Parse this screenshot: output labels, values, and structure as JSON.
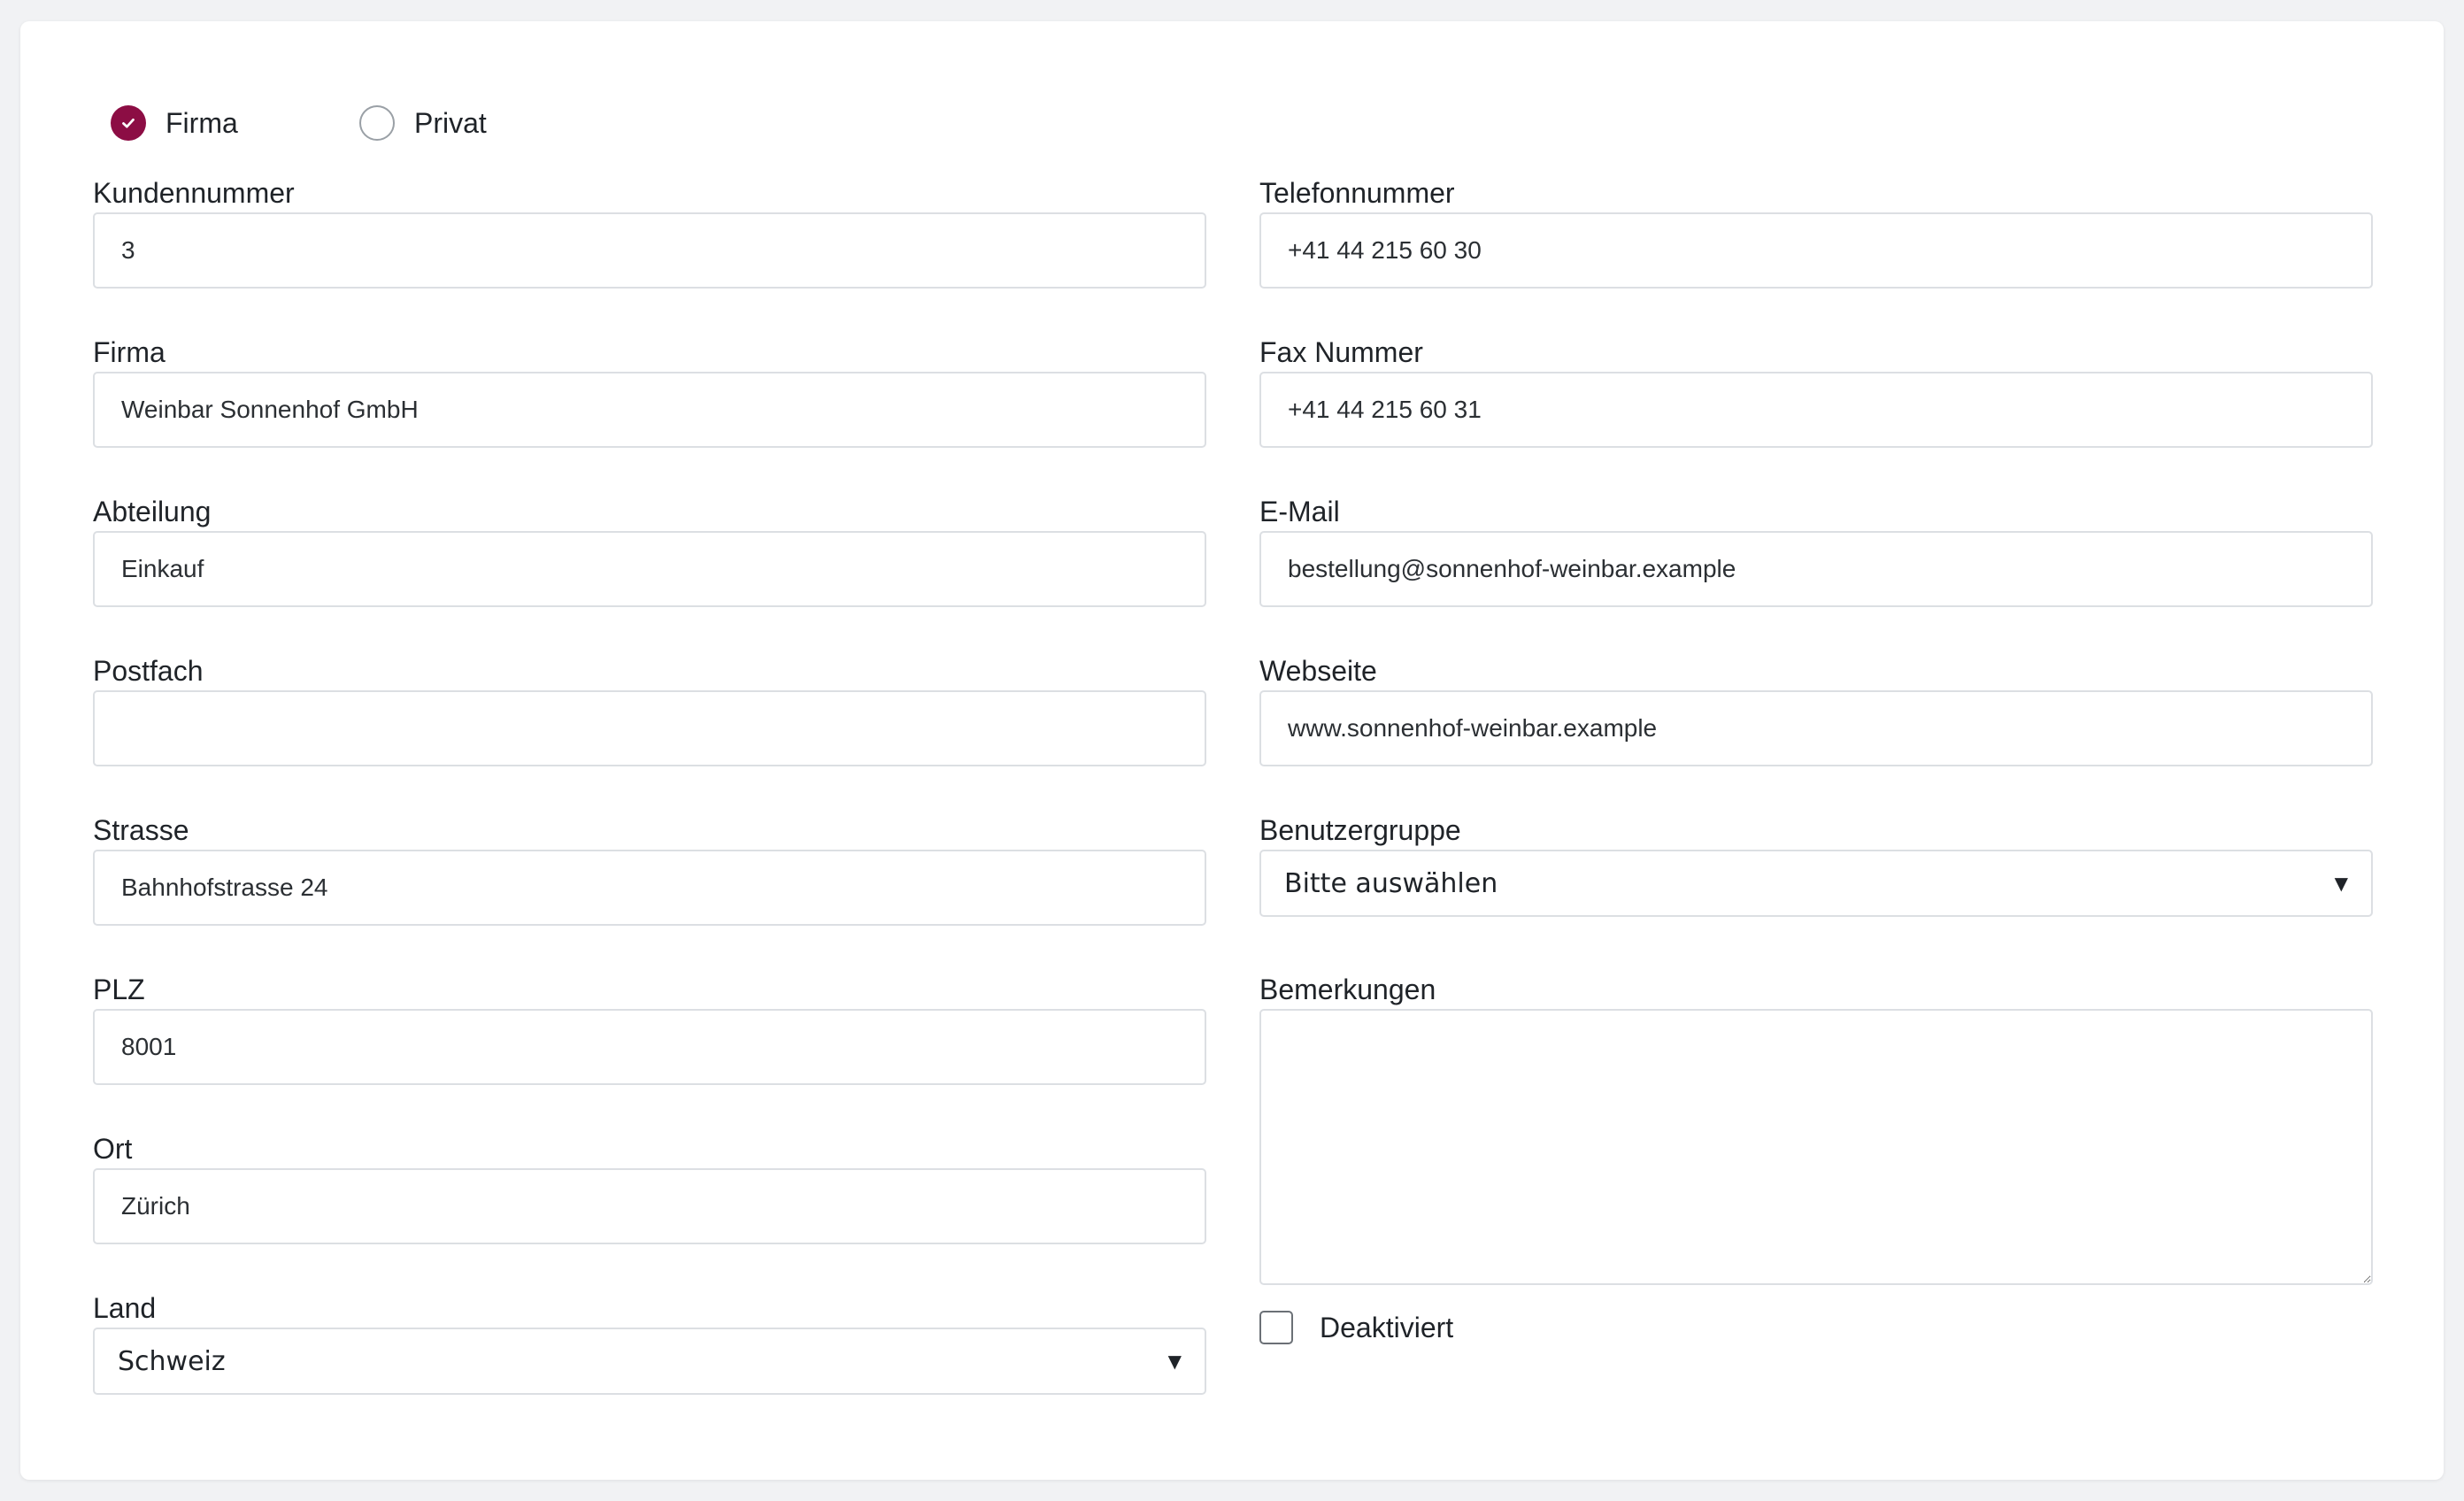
{
  "customer_type": {
    "options": [
      {
        "label": "Firma",
        "checked": true
      },
      {
        "label": "Privat",
        "checked": false
      }
    ]
  },
  "left": {
    "kundennummer": {
      "label": "Kundennummer",
      "value": "3"
    },
    "firma": {
      "label": "Firma",
      "value": "Weinbar Sonnenhof GmbH"
    },
    "abteilung": {
      "label": "Abteilung",
      "value": "Einkauf"
    },
    "postfach": {
      "label": "Postfach",
      "value": ""
    },
    "strasse": {
      "label": "Strasse",
      "value": "Bahnhofstrasse 24"
    },
    "plz": {
      "label": "PLZ",
      "value": "8001"
    },
    "ort": {
      "label": "Ort",
      "value": "Zürich"
    },
    "land": {
      "label": "Land",
      "selected": "Schweiz"
    }
  },
  "right": {
    "telefon": {
      "label": "Telefonnummer",
      "value": "+41 44 215 60 30"
    },
    "fax": {
      "label": "Fax Nummer",
      "value": "+41 44 215 60 31"
    },
    "email": {
      "label": "E-Mail",
      "value": "bestellung@sonnenhof-weinbar.example"
    },
    "webseite": {
      "label": "Webseite",
      "value": "www.sonnenhof-weinbar.example"
    },
    "benutzergruppe": {
      "label": "Benutzergruppe",
      "selected": "Bitte auswählen"
    },
    "bemerkungen": {
      "label": "Bemerkungen",
      "value": ""
    },
    "deaktiviert": {
      "label": "Deaktiviert",
      "checked": false
    }
  },
  "icons": {
    "radio_checked": "check-icon",
    "select_caret": "caret-down-icon"
  },
  "colors": {
    "accent": "#8c0d44",
    "background": "#f1f2f4",
    "card": "#ffffff",
    "input_border": "#dcdfe3"
  }
}
